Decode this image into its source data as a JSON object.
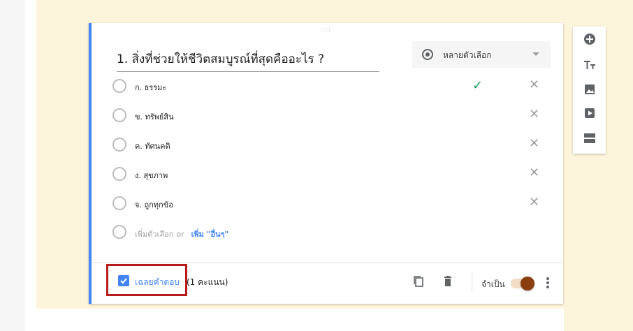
{
  "question": {
    "drag_glyph": ":::",
    "title": "1. สิ่งที่ช่วยให้ชีวิตสมบูรณ์ที่สุดคืออะไร ?",
    "type_label": "หลายตัวเลือก",
    "options": [
      {
        "label": "ก. ธรรมะ",
        "correct": true
      },
      {
        "label": "ข. ทรัพย์สิน",
        "correct": false
      },
      {
        "label": "ค. ทัศนคติ",
        "correct": false
      },
      {
        "label": "ง. สุขภาพ",
        "correct": false
      },
      {
        "label": "จ. ถูกทุกข้อ",
        "correct": false
      }
    ],
    "add_option_text": "เพิ่มตัวเลือก",
    "add_or_text": "or",
    "add_other_text": "เพิ่ม \"อื่นๆ\""
  },
  "footer": {
    "answer_key_label": "เฉลยคำตอบ",
    "points_label": "(1 คะแนน)",
    "required_label": "จำเป็น",
    "required_on": true
  },
  "colors": {
    "accent_blue": "#4285f4",
    "correct_green": "#0f9d58",
    "highlight_red": "#b71c1c",
    "toggle_knob": "#8b3e0f",
    "page_bg": "#fdf4dc"
  },
  "toolbar_icons": [
    "add-circle-icon",
    "title-text-icon",
    "image-icon",
    "video-icon",
    "section-icon"
  ]
}
